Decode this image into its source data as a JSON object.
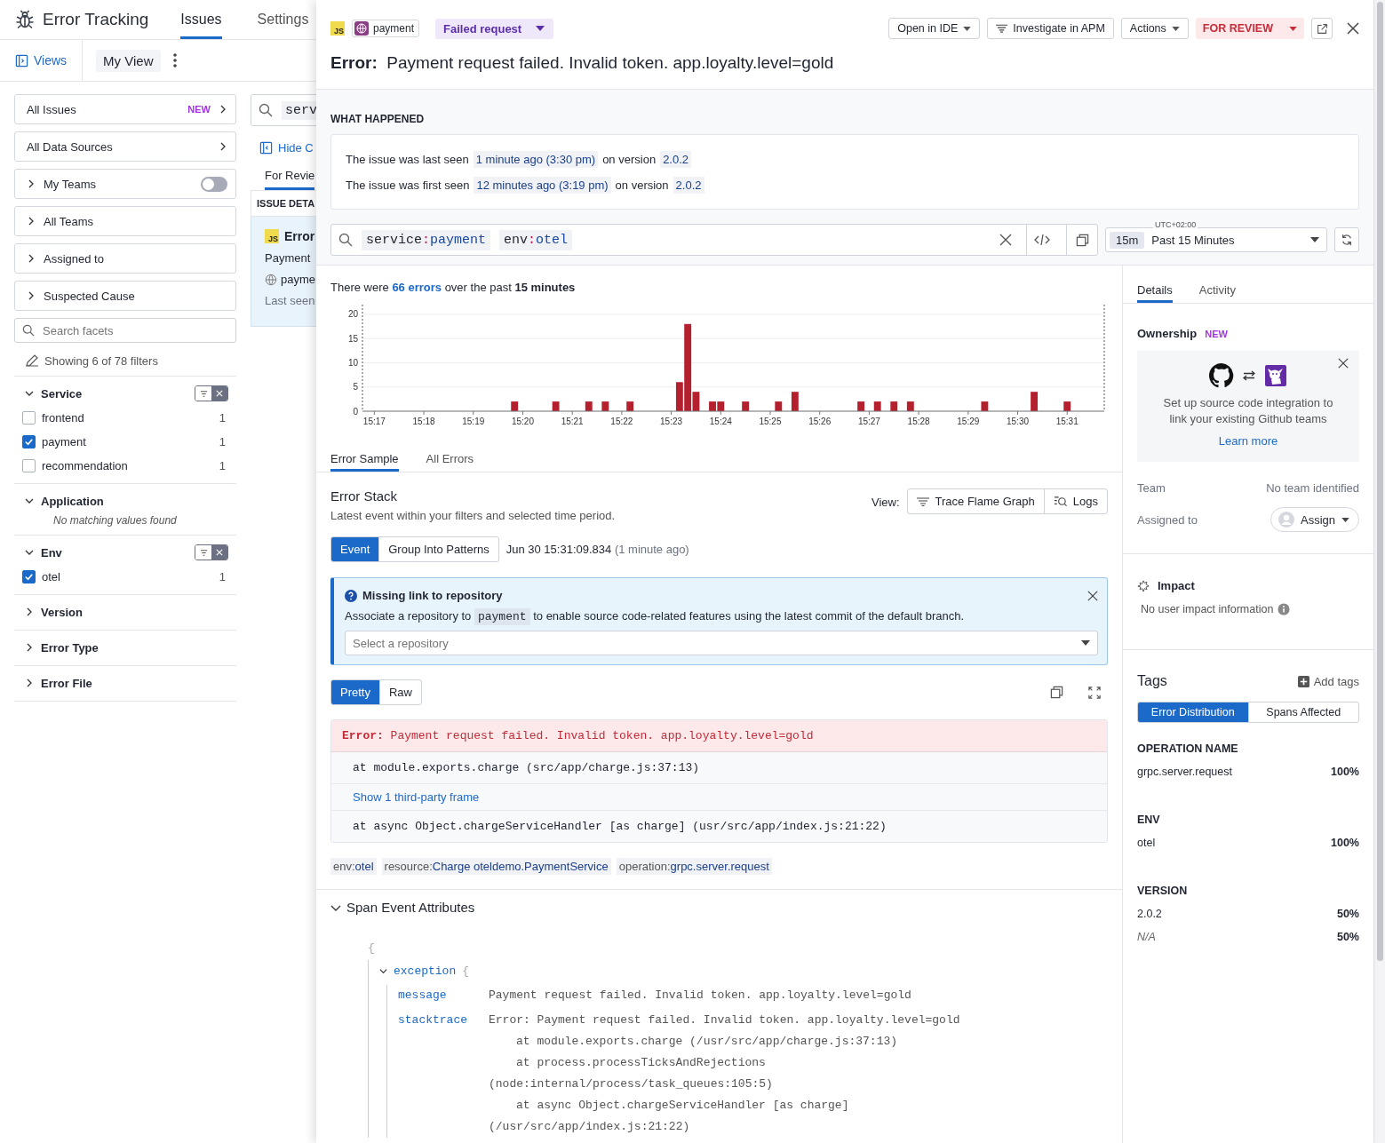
{
  "app": {
    "title": "Error Tracking",
    "tabs": [
      {
        "label": "Issues",
        "selected": true
      },
      {
        "label": "Settings",
        "selected": false
      }
    ]
  },
  "views": {
    "views_label": "Views",
    "current_view": "My View"
  },
  "facets": {
    "nav": [
      {
        "label": "All Issues",
        "kind": "link",
        "badge": "NEW"
      },
      {
        "label": "All Data Sources",
        "kind": "link"
      },
      {
        "label": "My Teams",
        "kind": "toggle",
        "on": false
      },
      {
        "label": "All Teams",
        "kind": "group"
      },
      {
        "label": "Assigned to",
        "kind": "group"
      },
      {
        "label": "Suspected Cause",
        "kind": "group"
      }
    ],
    "search_placeholder": "Search facets",
    "showing": "Showing 6 of 78 filters",
    "groups": [
      {
        "name": "Service",
        "expanded": true,
        "filtered": true,
        "values": [
          {
            "label": "frontend",
            "count": "1",
            "checked": false
          },
          {
            "label": "payment",
            "count": "1",
            "checked": true
          },
          {
            "label": "recommendation",
            "count": "1",
            "checked": false
          }
        ]
      },
      {
        "name": "Application",
        "expanded": true,
        "filtered": false,
        "empty_text": "No matching values found"
      },
      {
        "name": "Env",
        "expanded": true,
        "filtered": true,
        "values": [
          {
            "label": "otel",
            "count": "1",
            "checked": true
          }
        ]
      },
      {
        "name": "Version",
        "expanded": false,
        "filtered": false
      },
      {
        "name": "Error Type",
        "expanded": false,
        "filtered": false
      },
      {
        "name": "Error File",
        "expanded": false,
        "filtered": false
      }
    ]
  },
  "issue_list": {
    "search_text": "serv",
    "hide_link": "Hide C",
    "tabs": [
      {
        "label": "For Revie",
        "selected": true
      }
    ],
    "header": "ISSUE DETA",
    "card": {
      "language": "JS",
      "title": "Error",
      "subtitle": "Payment",
      "service": "payme",
      "last_seen": "Last seen"
    }
  },
  "drawer": {
    "language": "JS",
    "service": "payment",
    "issue_type": "Failed request",
    "buttons": [
      {
        "label": "Open in IDE",
        "kind": "dropdown"
      },
      {
        "label": "Investigate in APM",
        "kind": "icon"
      },
      {
        "label": "Actions",
        "kind": "dropdown"
      }
    ],
    "status": "FOR REVIEW",
    "title_label": "Error:",
    "title": "Payment request failed. Invalid token. app.loyalty.level=gold",
    "what_happened": {
      "heading": "WHAT HAPPENED",
      "lines": [
        {
          "prefix": "The issue was last seen",
          "time": "1 minute ago (3:30 pm)",
          "middle": "on version",
          "version": "2.0.2"
        },
        {
          "prefix": "The issue was first seen",
          "time": "12 minutes ago (3:19 pm)",
          "middle": "on version",
          "version": "2.0.2"
        }
      ]
    },
    "query": {
      "terms": [
        {
          "key": "service",
          "sep": ":",
          "value": "payment"
        },
        {
          "key": "env",
          "sep": ":",
          "value": "otel"
        }
      ]
    },
    "time": {
      "timezone": "UTC+02:00",
      "short": "15m",
      "range": "Past 15 Minutes"
    },
    "summary": {
      "pre": "There were",
      "count": "66 errors",
      "mid": "over the past",
      "period": "15 minutes"
    },
    "chart_data": {
      "type": "bar",
      "categories": [
        "15:17",
        null,
        null,
        null,
        null,
        null,
        "15:18",
        null,
        null,
        null,
        null,
        null,
        "15:19",
        null,
        null,
        null,
        null,
        null,
        "15:20",
        null,
        null,
        null,
        null,
        null,
        "15:21",
        null,
        null,
        null,
        null,
        null,
        "15:22",
        null,
        null,
        null,
        null,
        null,
        "15:23",
        null,
        null,
        null,
        null,
        null,
        "15:24",
        null,
        null,
        null,
        null,
        null,
        "15:25",
        null,
        null,
        null,
        null,
        null,
        "15:26",
        null,
        null,
        null,
        null,
        null,
        "15:27",
        null,
        null,
        null,
        null,
        null,
        "15:28",
        null,
        null,
        null,
        null,
        null,
        "15:29",
        null,
        null,
        null,
        null,
        null,
        "15:30",
        null,
        null,
        null,
        null,
        null,
        "15:31",
        null,
        null,
        null,
        null
      ],
      "series": [
        {
          "color": "#b5202e",
          "values": [
            0,
            0,
            0,
            0,
            0,
            0,
            0,
            0,
            0,
            0,
            0,
            0,
            0,
            0,
            0,
            0,
            0,
            2,
            0,
            0,
            0,
            0,
            2,
            0,
            0,
            0,
            2,
            0,
            2,
            0,
            0,
            2,
            0,
            0,
            0,
            0,
            0,
            6,
            18,
            4,
            0,
            2,
            2,
            0,
            0,
            2,
            0,
            0,
            0,
            2,
            0,
            4,
            0,
            0,
            0,
            0,
            0,
            0,
            0,
            2,
            0,
            2,
            0,
            2,
            0,
            2,
            0,
            0,
            0,
            0,
            0,
            0,
            0,
            0,
            2,
            0,
            0,
            0,
            0,
            0,
            4,
            0,
            0,
            0,
            2,
            0,
            0,
            0,
            0
          ]
        }
      ],
      "ylim": [
        0,
        22
      ],
      "yticks": [
        0,
        5,
        10,
        15,
        20
      ],
      "grid": true
    },
    "sample_tabs": [
      {
        "label": "Error Sample",
        "selected": true
      },
      {
        "label": "All Errors",
        "selected": false
      }
    ],
    "error_stack": {
      "title": "Error Stack",
      "subtitle": "Latest event within your filters and selected time period.",
      "view_label": "View:",
      "view_buttons": [
        "Trace Flame Graph",
        "Logs"
      ],
      "mode_buttons": [
        {
          "label": "Event",
          "selected": true
        },
        {
          "label": "Group Into Patterns",
          "selected": false
        }
      ],
      "timestamp": "Jun 30 15:31:09.834",
      "relative": "(1 minute ago)"
    },
    "notice": {
      "title": "Missing link to repository",
      "text_before": "Associate a repository to",
      "code": "payment",
      "text_after": "to enable source code-related features using the latest commit of the default branch.",
      "placeholder": "Select a repository"
    },
    "format_buttons": [
      {
        "label": "Pretty",
        "selected": true
      },
      {
        "label": "Raw",
        "selected": false
      }
    ],
    "stack": {
      "error_label": "Error:",
      "message": "Payment request failed. Invalid token. app.loyalty.level=gold",
      "frames": [
        {
          "kind": "frame",
          "text": "at module.exports.charge (src/app/charge.js:37:13)"
        },
        {
          "kind": "link",
          "text": "Show 1 third-party frame"
        },
        {
          "kind": "frame",
          "text": "at async Object.chargeServiceHandler [as charge] (usr/src/app/index.js:21:22)"
        }
      ]
    },
    "tags": [
      {
        "key": "env:",
        "value": "otel"
      },
      {
        "key": "resource:",
        "value": "Charge oteldemo.PaymentService"
      },
      {
        "key": "operation:",
        "value": "grpc.server.request"
      }
    ],
    "attributes": {
      "title": "Span Event Attributes",
      "expanded": true,
      "open_brace": "{",
      "object": {
        "key": "exception",
        "brace": "{",
        "expanded": true,
        "fields": [
          {
            "key": "message",
            "lines": [
              {
                "text": "Payment request failed. Invalid token. app.loyalty.level=gold",
                "indent": false
              }
            ]
          },
          {
            "key": "stacktrace",
            "lines": [
              {
                "text": "Error: Payment request failed. Invalid token. app.loyalty.level=gold",
                "indent": false
              },
              {
                "text": "at module.exports.charge (/usr/src/app/charge.js:37:13)",
                "indent": true
              },
              {
                "text": "at process.processTicksAndRejections",
                "indent": true
              },
              {
                "text": "(node:internal/process/task_queues:105:5)",
                "indent": false
              },
              {
                "text": "at async Object.chargeServiceHandler [as charge]",
                "indent": true
              },
              {
                "text": "(/usr/src/app/index.js:21:22)",
                "indent": false
              }
            ]
          }
        ]
      }
    }
  },
  "side": {
    "tabs": [
      {
        "label": "Details",
        "selected": true
      },
      {
        "label": "Activity",
        "selected": false
      }
    ],
    "ownership": {
      "heading": "Ownership",
      "badge": "NEW",
      "text": "Set up source code integration to link your existing Github teams",
      "link": "Learn more"
    },
    "team_label": "Team",
    "team_value": "No team identified",
    "assigned_label": "Assigned to",
    "assign_button": "Assign",
    "impact": {
      "title": "Impact",
      "text": "No user impact information"
    },
    "tags": {
      "heading": "Tags",
      "add": "Add tags",
      "toggles": [
        {
          "label": "Error Distribution",
          "selected": true
        },
        {
          "label": "Spans Affected",
          "selected": false
        }
      ],
      "groups": [
        {
          "name": "OPERATION NAME",
          "rows": [
            {
              "value": "grpc.server.request",
              "percent": "100%",
              "kind": "value"
            }
          ]
        },
        {
          "name": "ENV",
          "rows": [
            {
              "value": "otel",
              "percent": "100%",
              "kind": "value"
            }
          ]
        },
        {
          "name": "VERSION",
          "rows": [
            {
              "value": "2.0.2",
              "percent": "50%",
              "kind": "value"
            },
            {
              "value": "N/A",
              "percent": "50%",
              "kind": "missing"
            }
          ]
        }
      ]
    }
  }
}
